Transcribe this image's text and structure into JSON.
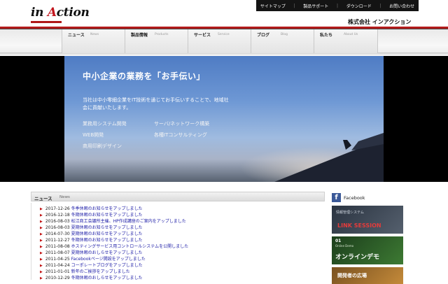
{
  "logo": {
    "first": "in ",
    "cap": "A",
    "rest": "ction"
  },
  "topnav": {
    "sitemap": "サイトマップ",
    "support": "製品サポート",
    "download": "ダウンロード",
    "contact": "お問い合わせ"
  },
  "company": "株式会社 インアクション",
  "nav": [
    {
      "jp": "ニュース",
      "en": "News"
    },
    {
      "jp": "製品情報",
      "en": "Products"
    },
    {
      "jp": "サービス",
      "en": "Service"
    },
    {
      "jp": "ブログ",
      "en": "Blog"
    },
    {
      "jp": "私たち",
      "en": "About Us"
    }
  ],
  "hero": {
    "title": "中小企業の業務を「お手伝い」",
    "desc": "当社は中小零細企業をIT技術を通じてお手伝いすることで、地域社会に貢献いたします。",
    "services": [
      "業務用システム開発",
      "サーバ/ネットワーク構築",
      "WEB開発",
      "各種ITコンサルティング",
      "商用印刷デザイン"
    ]
  },
  "news": {
    "title_jp": "ニュース",
    "title_en": "News",
    "items": [
      {
        "date": "2017-12-26",
        "text": "冬季休暇のお知らせをアップしました"
      },
      {
        "date": "2016-12-18",
        "text": "冬期休暇のお知らせをアップしました"
      },
      {
        "date": "2016-08-03",
        "text": "松江商工会議所主催、HP作成講座のご案内をアップしました"
      },
      {
        "date": "2016-08-03",
        "text": "夏期休暇のお知らせをアップしました"
      },
      {
        "date": "2014-07-30",
        "text": "夏期休暇のお知らせをアップしました"
      },
      {
        "date": "2011-12-27",
        "text": "冬期休暇のお知らせをアップしました"
      },
      {
        "date": "2011-08-08",
        "text": "ホスティングサービス用コントロールシステムを公開しました"
      },
      {
        "date": "2011-08-07",
        "text": "夏期休暇のおしらせをアップしました"
      },
      {
        "date": "2011-04-25",
        "text": "Facebookページ開設をアップしました"
      },
      {
        "date": "2011-04-24",
        "text": "コーポレートブログをアップしました"
      },
      {
        "date": "2011-01-01",
        "text": "新年のご挨拶をアップしました"
      },
      {
        "date": "2010-12-29",
        "text": "冬期休暇のおしらせをアップしました"
      }
    ]
  },
  "sidebar": {
    "facebook": "Facebook",
    "banner1_sub": "情報管理システム",
    "banner1_title": "LINK SESSION",
    "banner2_num": "01",
    "banner2_sub": "Online Demo",
    "banner2_title": "オンラインデモ",
    "banner3_title": "開発者の広場"
  }
}
